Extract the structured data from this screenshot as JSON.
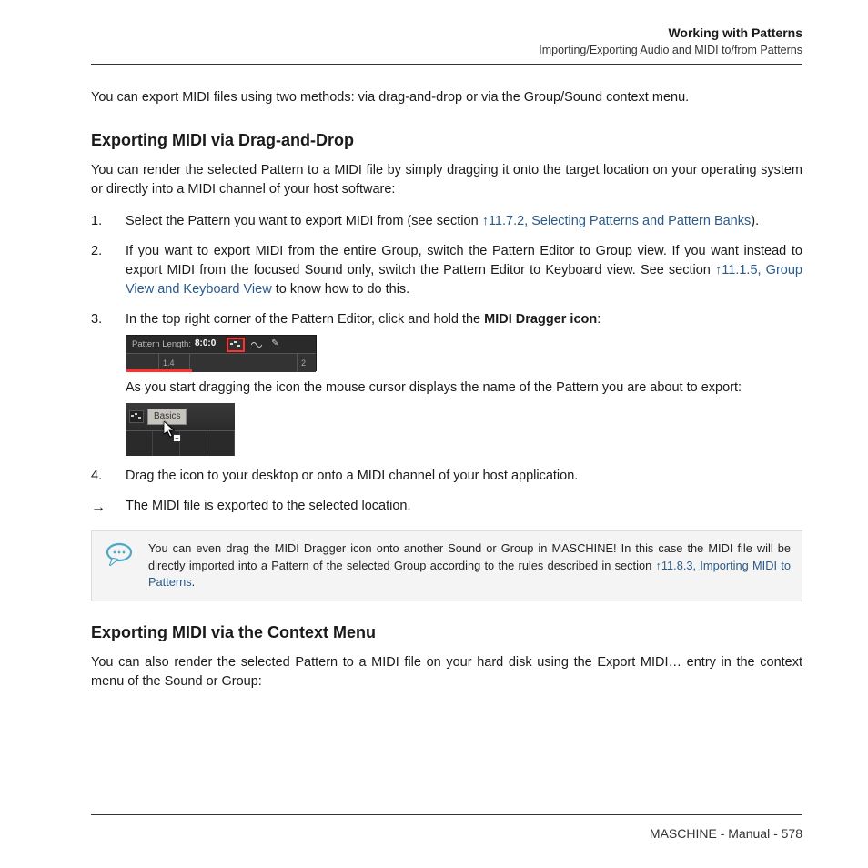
{
  "header": {
    "title": "Working with Patterns",
    "subtitle": "Importing/Exporting Audio and MIDI to/from Patterns"
  },
  "intro": "You can export MIDI files using two methods: via drag-and-drop or via the Group/Sound context menu.",
  "section1": {
    "heading": "Exporting MIDI via Drag-and-Drop",
    "lead": "You can render the selected Pattern to a MIDI file by simply dragging it onto the target location on your operating system or directly into a MIDI channel of your host software:",
    "step1_a": "Select the Pattern you want to export MIDI from (see section ",
    "step1_link": "↑11.7.2, Selecting Patterns and Pattern Banks",
    "step1_b": ").",
    "step2_a": "If you want to export MIDI from the entire Group, switch the Pattern Editor to Group view. If you want instead to export MIDI from the focused Sound only, switch the Pattern Editor to Keyboard view. See section ",
    "step2_link": "↑11.1.5, Group View and Keyboard View",
    "step2_b": " to know how to do this.",
    "step3_a": "In the top right corner of the Pattern Editor, click and hold the ",
    "step3_bold": "MIDI Dragger icon",
    "step3_b": ":",
    "fig1": {
      "length_label": "Pattern Length:",
      "length_value": "8:0:0",
      "tick": "1.4",
      "end": "2"
    },
    "step3_after": "As you start dragging the icon the mouse cursor displays the name of the Pattern you are about to export:",
    "fig2": {
      "label": "Basics"
    },
    "step4": "Drag the icon to your desktop or onto a MIDI channel of your host application.",
    "result": "The MIDI file is exported to the selected location.",
    "callout_a": "You can even drag the MIDI Dragger icon onto another Sound or Group in MASCHINE! In this case the MIDI file will be directly imported into a Pattern of the selected Group according to the rules described in section ",
    "callout_link": "↑11.8.3, Importing MIDI to Patterns",
    "callout_b": "."
  },
  "section2": {
    "heading": "Exporting MIDI via the Context Menu",
    "para": "You can also render the selected Pattern to a MIDI file on your hard disk using the Export MIDI… entry in the context menu of the Sound or Group:"
  },
  "footer": {
    "product": "MASCHINE",
    "doc": "Manual",
    "page": "578"
  }
}
